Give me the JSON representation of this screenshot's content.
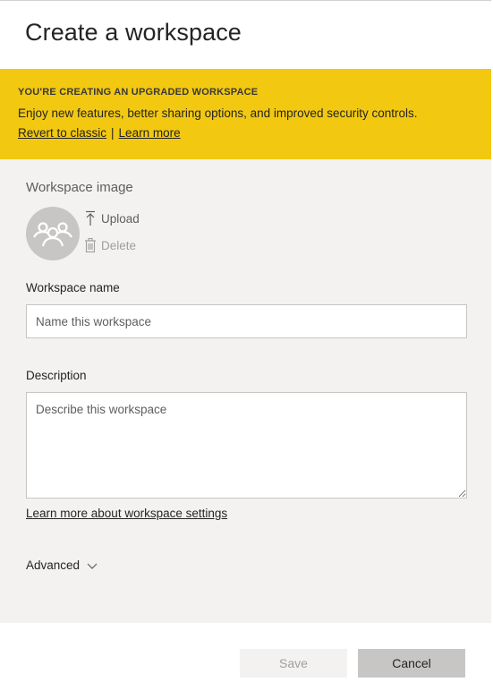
{
  "dialog": {
    "title": "Create a workspace"
  },
  "banner": {
    "title": "YOU'RE CREATING AN UPGRADED WORKSPACE",
    "text": "Enjoy new features, better sharing options, and improved security controls.",
    "revert_link": "Revert to classic",
    "separator": "|",
    "learn_more_link": "Learn more",
    "color": "#f2c811"
  },
  "workspace_image": {
    "label": "Workspace image",
    "avatar_icon": "group-people-icon",
    "upload_label": "Upload",
    "upload_icon": "upload-icon",
    "delete_label": "Delete",
    "delete_icon": "trash-icon"
  },
  "workspace_name": {
    "label": "Workspace name",
    "value": "",
    "placeholder": "Name this workspace"
  },
  "description": {
    "label": "Description",
    "value": "",
    "placeholder": "Describe this workspace"
  },
  "learn_more_settings": "Learn more about workspace settings",
  "advanced": {
    "label": "Advanced",
    "icon": "chevron-down-icon"
  },
  "footer": {
    "save_label": "Save",
    "cancel_label": "Cancel"
  }
}
